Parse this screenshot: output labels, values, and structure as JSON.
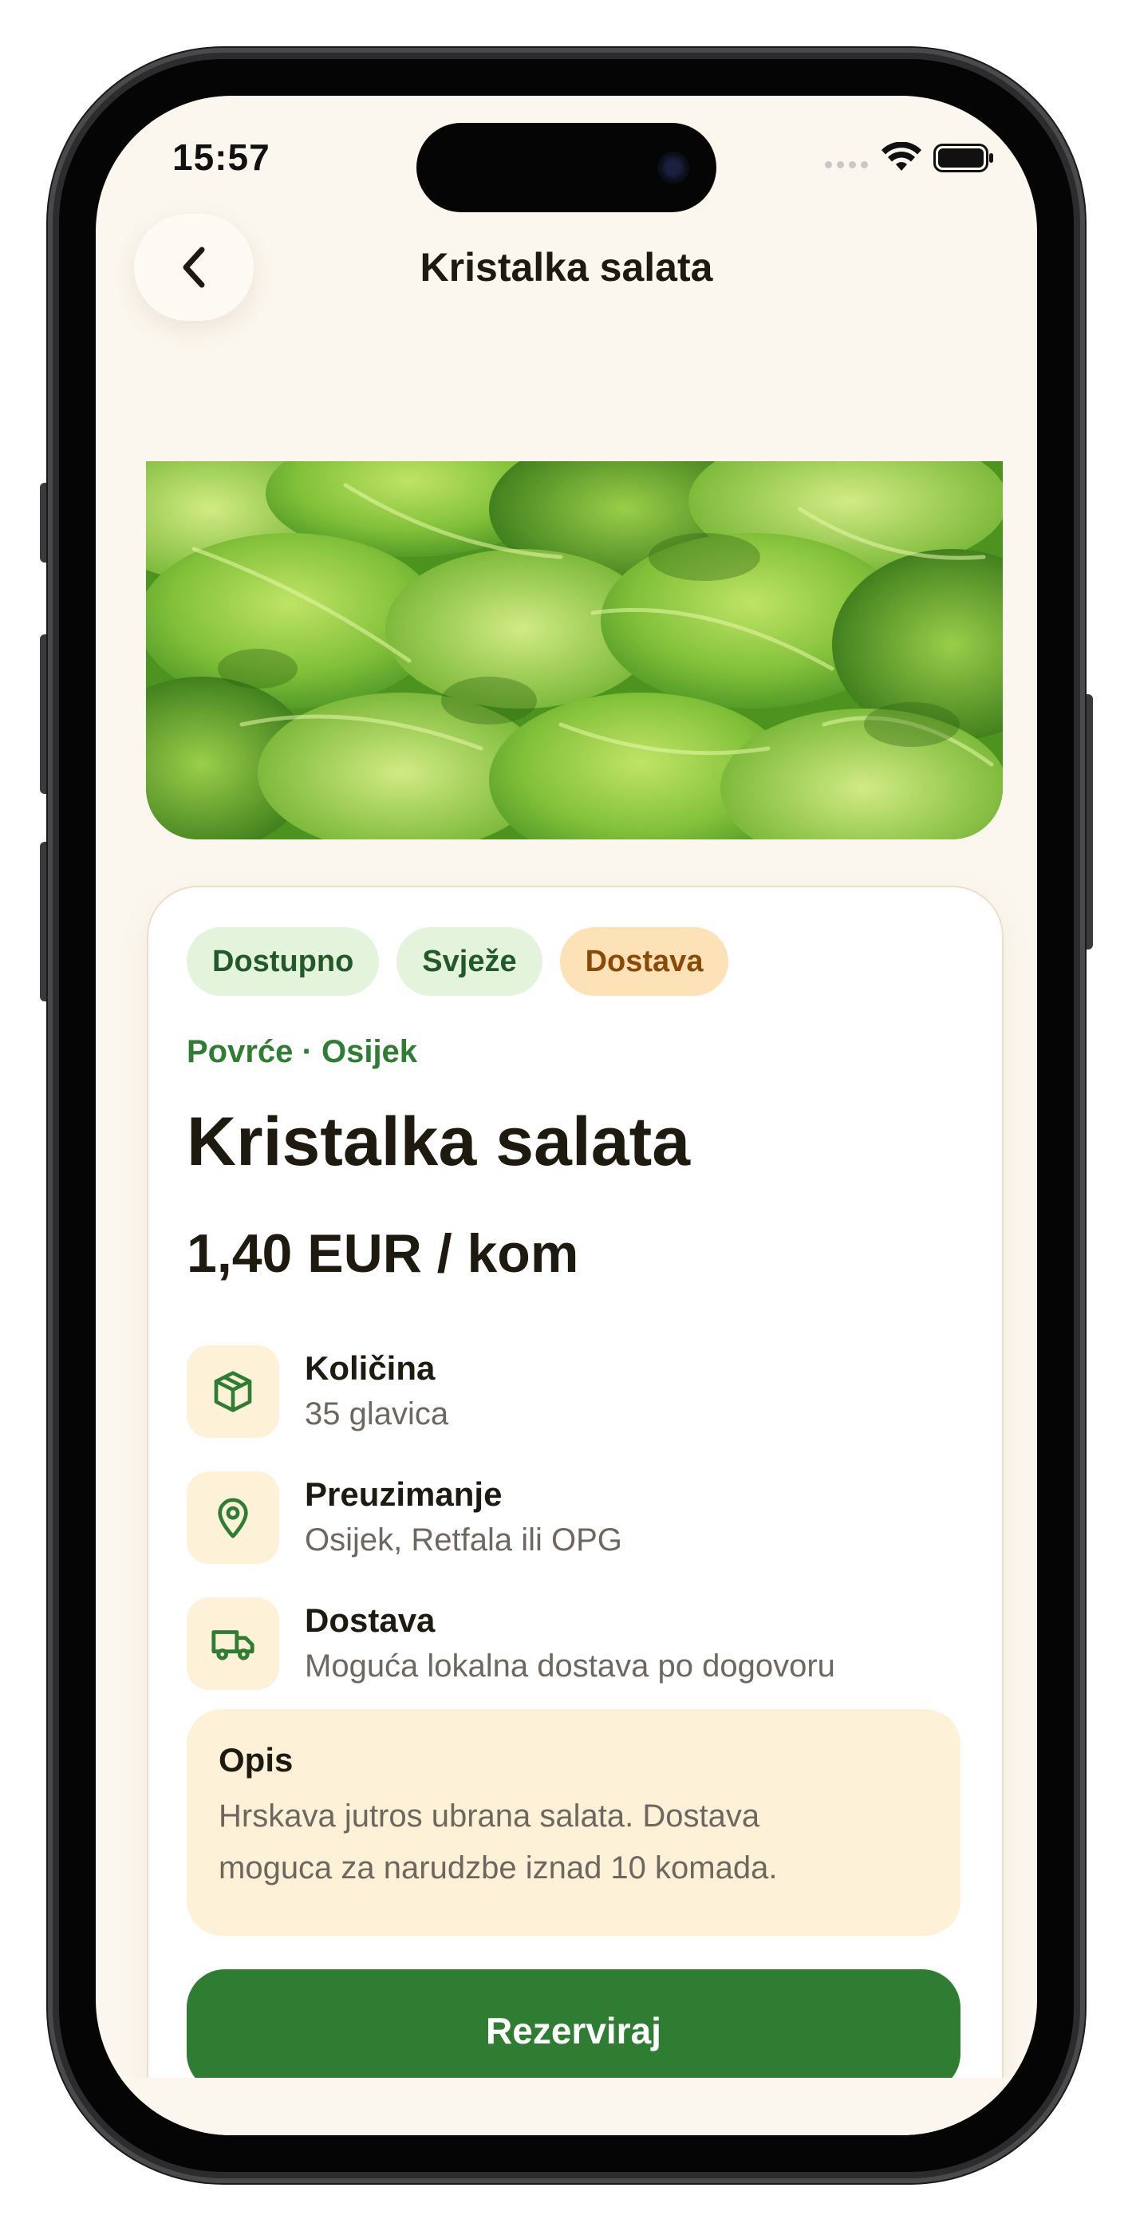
{
  "status_bar": {
    "time": "15:57"
  },
  "nav": {
    "title": "Kristalka salata"
  },
  "product": {
    "chips": [
      {
        "label": "Dostupno",
        "color": "#e3f3dc"
      },
      {
        "label": "Svježe",
        "color": "#e3f3dc"
      },
      {
        "label": "Dostava",
        "color": "#fde2b8"
      }
    ],
    "category": "Povrće · Osijek",
    "title": "Kristalka salata",
    "price": "1,40 EUR / kom",
    "details": [
      {
        "icon": "box-icon",
        "label": "Količina",
        "value": "35 glavica"
      },
      {
        "icon": "location-pin-icon",
        "label": "Preuzimanje",
        "value": "Osijek, Retfala ili OPG"
      },
      {
        "icon": "truck-icon",
        "label": "Dostava",
        "value": "Moguća lokalna dostava po dogovoru"
      }
    ],
    "description": {
      "title": "Opis",
      "text_line1": "Hrskava jutros ubrana salata. Dostava",
      "text_line2": "moguca za narudzbe iznad 10 komada."
    },
    "reserve_label": "Rezerviraj"
  },
  "colors": {
    "accent": "#2e7d32",
    "background": "#fbf7ee",
    "chip_green": "#e3f3dc",
    "chip_orange": "#fde2b8",
    "description_bg": "#fdf2d8"
  }
}
